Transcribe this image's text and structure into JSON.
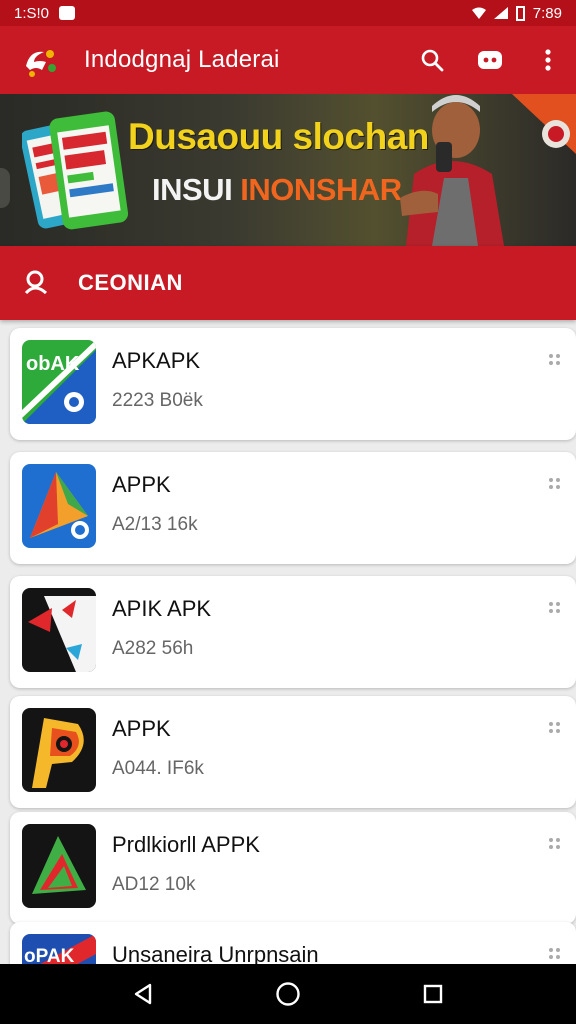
{
  "status_bar": {
    "time_left": "1:S!0",
    "time_right": "7:89"
  },
  "app_bar": {
    "title": "Indodgnaj Laderai"
  },
  "banner": {
    "headline": "Dusaouu slochan",
    "sub_a": "INSUI ",
    "sub_b": "INONSHAR"
  },
  "category": {
    "label": "CEONIAN"
  },
  "apps": [
    {
      "name": "APKAPK",
      "meta": "2223  B0ëk",
      "icon": "apk-green-blue-icon"
    },
    {
      "name": "APPK",
      "meta": "A2/13  16k",
      "icon": "apk-blue-triangle-icon"
    },
    {
      "name": "APIK APK",
      "meta": "A282  56h",
      "icon": "apk-black-red-icon"
    },
    {
      "name": "APPK",
      "meta": "A044. IF6k",
      "icon": "apk-orange-p-icon"
    },
    {
      "name": "Prdlkiorll APPK",
      "meta": "AD12  10k",
      "icon": "apk-green-red-icon"
    },
    {
      "name": "Unsaneira Unrpnsain",
      "meta": "",
      "icon": "apk-red-blue-icon"
    }
  ],
  "colors": {
    "primary": "#c81a25",
    "status": "#b4101a",
    "banner_headline": "#f2d21b",
    "banner_accent": "#f0661e"
  }
}
